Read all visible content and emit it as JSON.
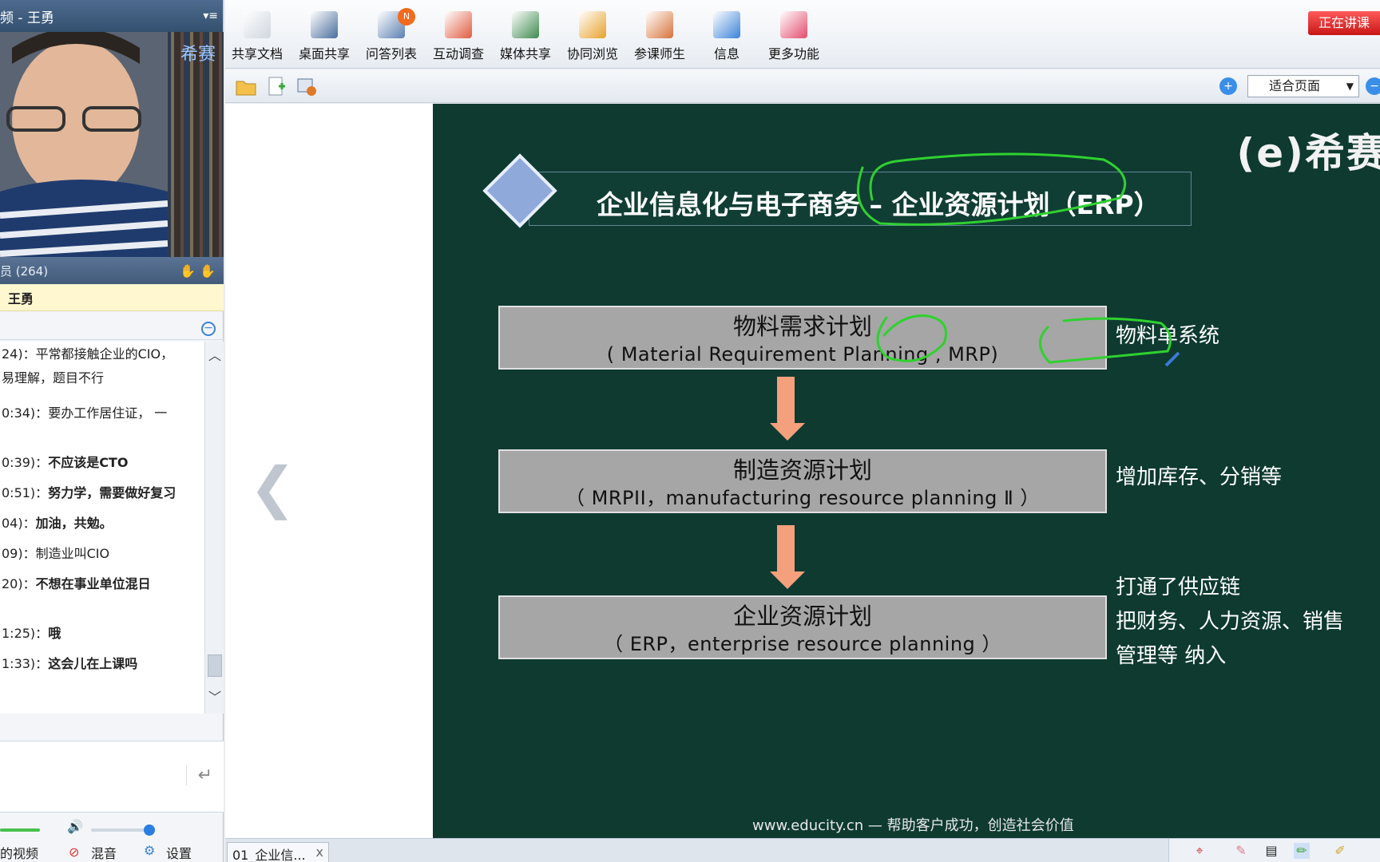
{
  "left_panel": {
    "title": "频 - 王勇",
    "attendees": "员 (264)",
    "speaker": "王勇",
    "chat": [
      {
        "time": "24)：",
        "text": "平常都接触企业的CIO，",
        "bold": false
      },
      {
        "time": "",
        "text": "易理解，题目不行",
        "bold": false
      },
      {
        "time": "0:34)：",
        "text": "要办工作居住证， 一",
        "bold": false
      },
      {
        "time": "0:39)：",
        "text": "不应该是CTO",
        "bold": true
      },
      {
        "time": "0:51)：",
        "text": "努力学，需要做好复习",
        "bold": true
      },
      {
        "time": "04)：",
        "text": "加油，共勉。",
        "bold": true
      },
      {
        "time": "09)：",
        "text": "制造业叫CIO",
        "bold": false
      },
      {
        "time": "20)：",
        "text": "不想在事业单位混日",
        "bold": true
      },
      {
        "time": "1:25)：",
        "text": "哦",
        "bold": true
      },
      {
        "time": "1:33)：",
        "text": "这会儿在上课吗",
        "bold": true
      }
    ],
    "controls": {
      "video": "的视频",
      "mix": "混音",
      "settings": "设置"
    },
    "video_watermark": "希赛"
  },
  "toolbar": {
    "items": [
      {
        "label": "共享文档",
        "color": "#cfd6de"
      },
      {
        "label": "桌面共享",
        "color": "#4a6e9c"
      },
      {
        "label": "问答列表",
        "color": "#5b7fb0"
      },
      {
        "label": "互动调查",
        "color": "#e05b3f"
      },
      {
        "label": "媒体共享",
        "color": "#3e8a4e"
      },
      {
        "label": "协同浏览",
        "color": "#e8a12b"
      },
      {
        "label": "参课师生",
        "color": "#d8743a"
      },
      {
        "label": "信息",
        "color": "#3b82d8"
      },
      {
        "label": "更多功能",
        "color": "#e34b6e"
      }
    ],
    "badge": "N",
    "live_label": "正在讲课"
  },
  "subbar": {
    "zoom_value": "适合页面"
  },
  "slide": {
    "brand": "(e)希赛",
    "title": "企业信息化与电子商务 – 企业资源计划（ERP）",
    "boxes": [
      {
        "main": "物料需求计划",
        "sub": "( Material Requirement Planning , MRP)"
      },
      {
        "main": "制造资源计划",
        "sub": "（ MRPII，manufacturing resource planning Ⅱ ）"
      },
      {
        "main": "企业资源计划",
        "sub": "（ ERP，enterprise resource planning ）"
      }
    ],
    "notes": [
      "物料单系统",
      "增加库存、分销等",
      "打通了供应链",
      "把财务、人力资源、销售",
      "管理等 纳入"
    ],
    "footer": "www.educity.cn — 帮助客户成功，创造社会价值",
    "ink_color": "#2fd12f"
  },
  "bottom": {
    "tab_label": "01_企业信...",
    "tab_close": "x"
  }
}
